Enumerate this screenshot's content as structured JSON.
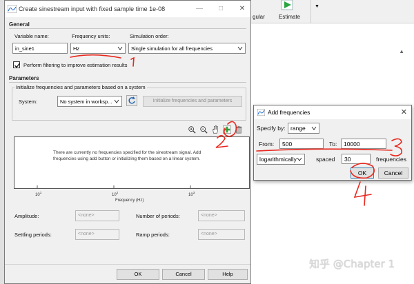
{
  "background": {
    "ribbon_button_partial": "gular",
    "estimate_label": "Estimate",
    "collapse_arrow": "▲",
    "watermark": "知乎 @Chapter 1"
  },
  "dialog": {
    "title": "Create sinestream input with fixed sample time 1e-08",
    "window_buttons": {
      "minimize": "—",
      "maximize": "□",
      "close": "✕"
    },
    "general": {
      "group_label": "General",
      "variable_name_label": "Variable name:",
      "variable_name_value": "in_sine1",
      "frequency_units_label": "Frequency units:",
      "frequency_units_value": "Hz",
      "simulation_order_label": "Simulation order:",
      "simulation_order_value": "Single simulation for all frequencies",
      "filtering_label": "Perform filtering to improve estimation results",
      "filtering_checked": true
    },
    "parameters": {
      "group_label": "Parameters",
      "init_group_label": "Initialize frequencies and parameters based on a system",
      "system_label": "System:",
      "system_value": "No system in worksp...",
      "init_button": "Initialize frequencies and parameters",
      "plot_message": "There are currently no frequencies specified for the sinestream signal. Add frequencies using add button or initializing them based on a linear system.",
      "x_ticks": [
        "10",
        "10",
        "10"
      ],
      "x_tick_exponents": [
        "1",
        "2",
        "3"
      ],
      "xlabel": "Frequency (Hz)",
      "amplitude_label": "Amplitude:",
      "amplitude_value": "<none>",
      "num_periods_label": "Number of periods:",
      "num_periods_value": "<none>",
      "settling_label": "Settling periods:",
      "settling_value": "<none>",
      "ramp_label": "Ramp periods:",
      "ramp_value": "<none>"
    },
    "buttons": {
      "ok": "OK",
      "cancel": "Cancel",
      "help": "Help"
    }
  },
  "add_frequencies": {
    "title": "Add frequencies",
    "specify_by_label": "Specify by:",
    "specify_by_value": "range",
    "from_label": "From:",
    "from_value": "500",
    "to_label": "To:",
    "to_value": "10000",
    "spacing_value": "logarithmically",
    "spaced_label": "spaced",
    "count_value": "30",
    "frequencies_label": "frequencies",
    "ok": "OK",
    "cancel": "Cancel"
  },
  "annotations": {
    "n1": "1",
    "n2": "2",
    "n3": "3",
    "n4": "4",
    "color": "#e8281e"
  }
}
